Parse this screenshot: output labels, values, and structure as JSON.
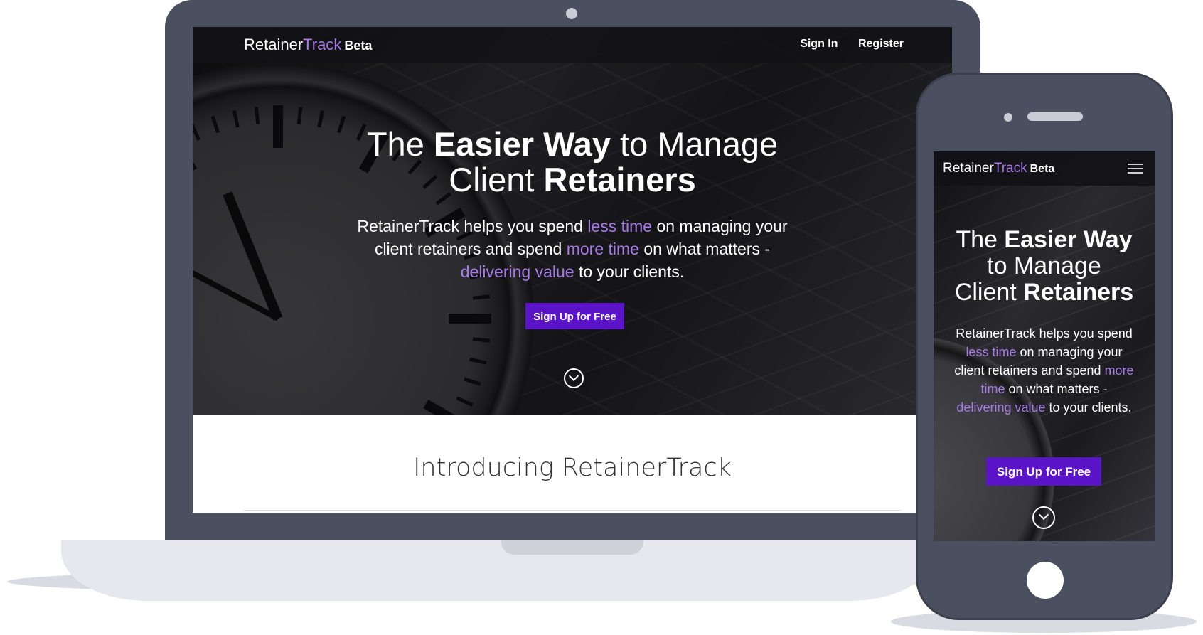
{
  "brand": {
    "name_part1": "Retainer",
    "name_part2": "Track",
    "badge": "Beta",
    "accent_color": "#a57be6",
    "button_color": "#5b13c8",
    "device_color": "#4b5060"
  },
  "nav": {
    "sign_in": "Sign In",
    "register": "Register",
    "menu_icon": "hamburger-icon"
  },
  "hero": {
    "title_1": "The ",
    "title_2": "Easier Way",
    "title_3": " to Manage",
    "title_4": "Client ",
    "title_5": "Retainers",
    "text_1": "RetainerTrack helps you spend ",
    "text_2": "less time",
    "text_3": " on managing your client retainers and spend ",
    "text_4": "more time",
    "text_5": " on what matters - ",
    "text_6": "delivering value",
    "text_7": " to your clients.",
    "cta": "Sign Up for Free",
    "scroll_icon": "chevron-down-icon"
  },
  "intro": {
    "title": "Introducing RetainerTrack"
  }
}
